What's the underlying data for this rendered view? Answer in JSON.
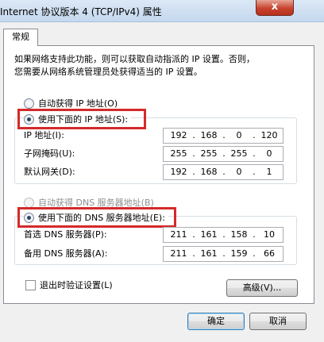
{
  "window": {
    "title": "Internet 协议版本 4 (TCP/IPv4) 属性",
    "close_glyph": "x"
  },
  "tabs": [
    {
      "label": "常规"
    }
  ],
  "description": {
    "line1": "如果网络支持此功能，则可以获取自动指派的 IP 设置。否则，",
    "line2": "您需要从网络系统管理员处获得适当的 IP 设置。"
  },
  "ip_section": {
    "auto_radio_label": "自动获得 IP 地址(O)",
    "auto_selected": false,
    "manual_radio_label": "使用下面的 IP 地址(S):",
    "manual_selected": true,
    "fields": [
      {
        "label": "IP 地址(I):",
        "octets": [
          "192",
          "168",
          "0",
          "120"
        ]
      },
      {
        "label": "子网掩码(U):",
        "octets": [
          "255",
          "255",
          "255",
          "0"
        ]
      },
      {
        "label": "默认网关(D):",
        "octets": [
          "192",
          "168",
          "0",
          "1"
        ]
      }
    ]
  },
  "dns_section": {
    "auto_radio_label": "自动获得 DNS 服务器地址(B)",
    "auto_enabled": false,
    "manual_radio_label": "使用下面的 DNS 服务器地址(E):",
    "manual_selected": true,
    "fields": [
      {
        "label": "首选 DNS 服务器(P):",
        "octets": [
          "211",
          "161",
          "158",
          "10"
        ]
      },
      {
        "label": "备用 DNS 服务器(A):",
        "octets": [
          "211",
          "161",
          "159",
          "66"
        ]
      }
    ]
  },
  "validate_checkbox": {
    "label": "退出时验证设置(L)",
    "checked": false
  },
  "buttons": {
    "advanced": "高级(V)...",
    "ok": "确定",
    "cancel": "取消"
  },
  "highlight_color": "#d42a2a"
}
